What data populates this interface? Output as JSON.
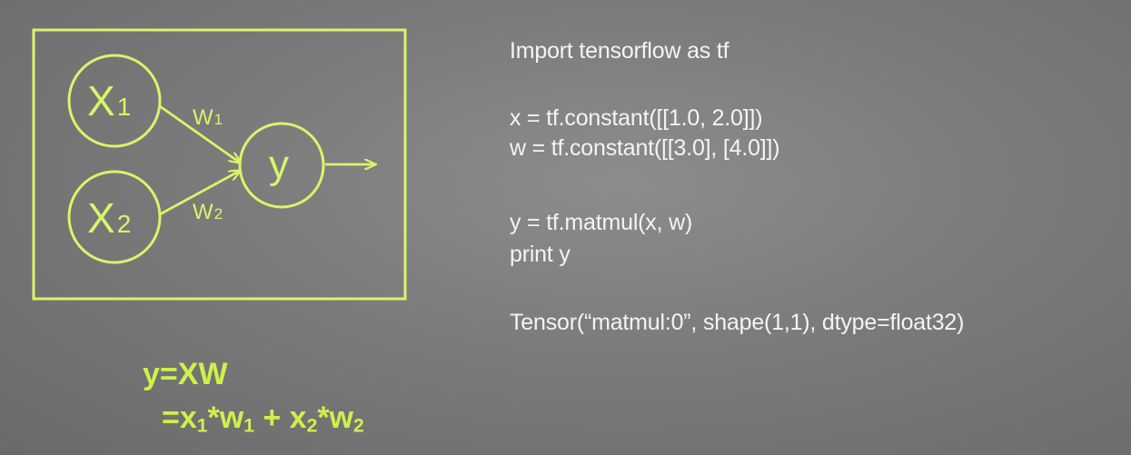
{
  "diagram": {
    "input_1": {
      "base": "X",
      "sub": "1"
    },
    "input_2": {
      "base": "X",
      "sub": "2"
    },
    "weight_1": {
      "base": "W",
      "sub": "1"
    },
    "weight_2": {
      "base": "W",
      "sub": "2"
    },
    "output": "y"
  },
  "code": {
    "line_1": "Import tensorflow as tf",
    "line_2": "x = tf.constant([[1.0, 2.0]])",
    "line_3": "w = tf.constant([[3.0], [4.0]])",
    "line_4": "y = tf.matmul(x, w)",
    "line_5": "print y",
    "line_6": "Tensor(“matmul:0”, shape(1,1), dtype=float32)"
  },
  "formula": {
    "line_1": "y=XW",
    "line_2": {
      "prefix": "=x",
      "sub_a": "1",
      "op_a": "*w",
      "sub_b": "1",
      "plus": " + x",
      "sub_c": "2",
      "op_b": "*w",
      "sub_d": "2"
    }
  },
  "colors": {
    "background": "#7b7b7b",
    "accent": "#d8f56a",
    "formula": "#cdf04c",
    "text": "#f4f4f4"
  }
}
